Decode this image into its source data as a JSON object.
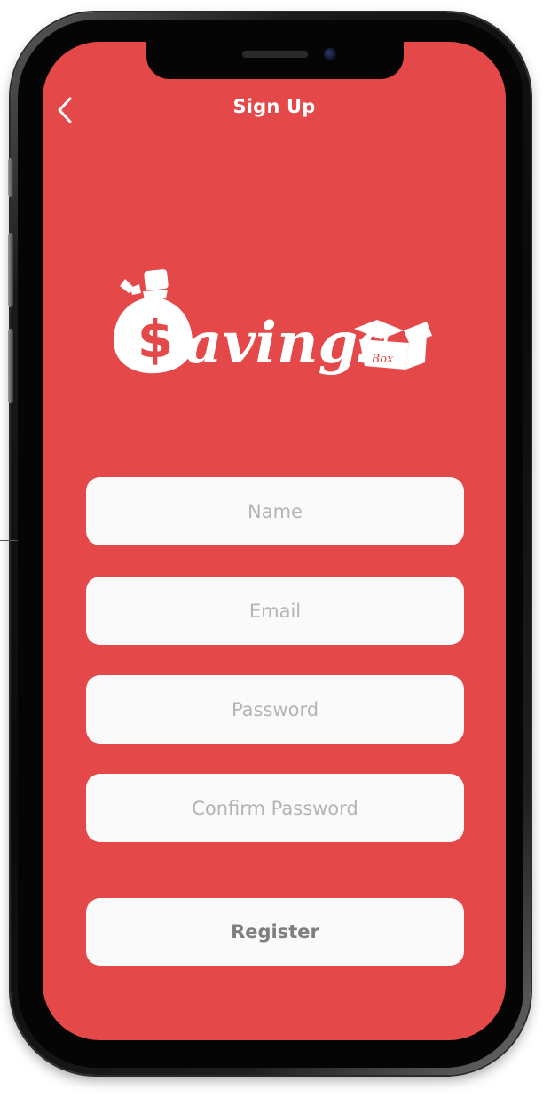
{
  "header": {
    "title": "Sign Up",
    "back_icon": "chevron-left-icon"
  },
  "logo": {
    "wordmark": "$avings",
    "box_label": "Box"
  },
  "form": {
    "name_placeholder": "Name",
    "email_placeholder": "Email",
    "password_placeholder": "Password",
    "confirm_password_placeholder": "Confirm Password",
    "register_label": "Register"
  },
  "colors": {
    "background": "#e54848",
    "field": "#fafafa",
    "placeholder": "#b4b4b4",
    "button_text": "#7f7f7f"
  }
}
